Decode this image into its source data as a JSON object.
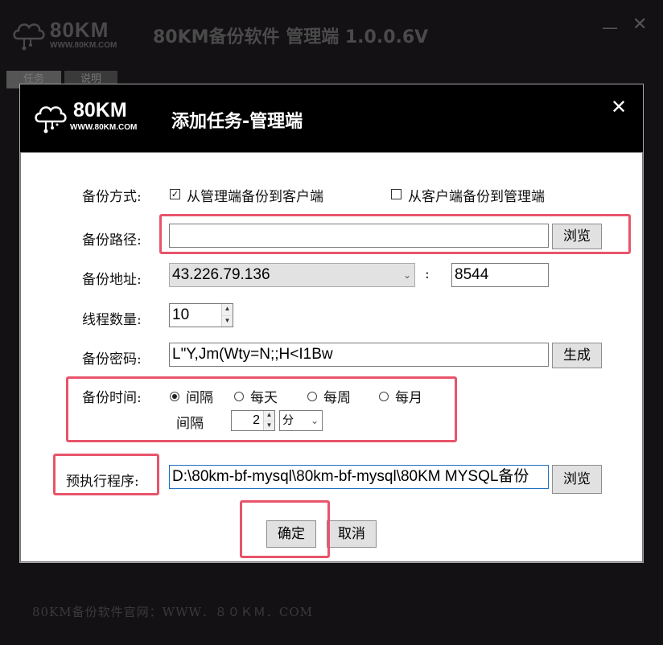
{
  "app": {
    "logo_text": "80KM",
    "logo_sub": "WWW.80KM.COM",
    "title": "80KM备份软件 管理端 1.0.0.6V",
    "minimize": "—",
    "close": "✕",
    "tabs": [
      "任务",
      "说明"
    ],
    "footer": "80KM备份软件官网：WWW．８０ＫＭ．COM"
  },
  "dialog": {
    "logo_text": "80KM",
    "logo_sub": "WWW.80KM.COM",
    "title": "添加任务-管理端",
    "close": "✕",
    "backup_mode": {
      "label": "备份方式:",
      "option1": "从管理端备份到客户端",
      "option1_checked": true,
      "option2": "从客户端备份到管理端",
      "option2_checked": false
    },
    "backup_path": {
      "label": "备份路径:",
      "value": "",
      "browse": "浏览"
    },
    "backup_address": {
      "label": "备份地址:",
      "ip": "43.226.79.136",
      "colon": ":",
      "port": "8544"
    },
    "threads": {
      "label": "线程数量:",
      "value": "10"
    },
    "password": {
      "label": "备份密码:",
      "value": "L\"Y,Jm(Wty=N;;H<I1Bw",
      "generate": "生成"
    },
    "backup_time": {
      "label": "备份时间:",
      "options": [
        "间隔",
        "每天",
        "每周",
        "每月"
      ],
      "selected": "间隔",
      "interval_label": "间隔",
      "interval_value": "2",
      "interval_unit": "分"
    },
    "pre_exec": {
      "label": "预执行程序:",
      "value": "D:\\80km-bf-mysql\\80km-bf-mysql\\80KM MYSQL备份",
      "browse": "浏览"
    },
    "ok": "确定",
    "cancel": "取消"
  },
  "colors": {
    "highlight": "#e8546a",
    "header_bg": "#000000",
    "button_bg": "#e1e1e1"
  }
}
